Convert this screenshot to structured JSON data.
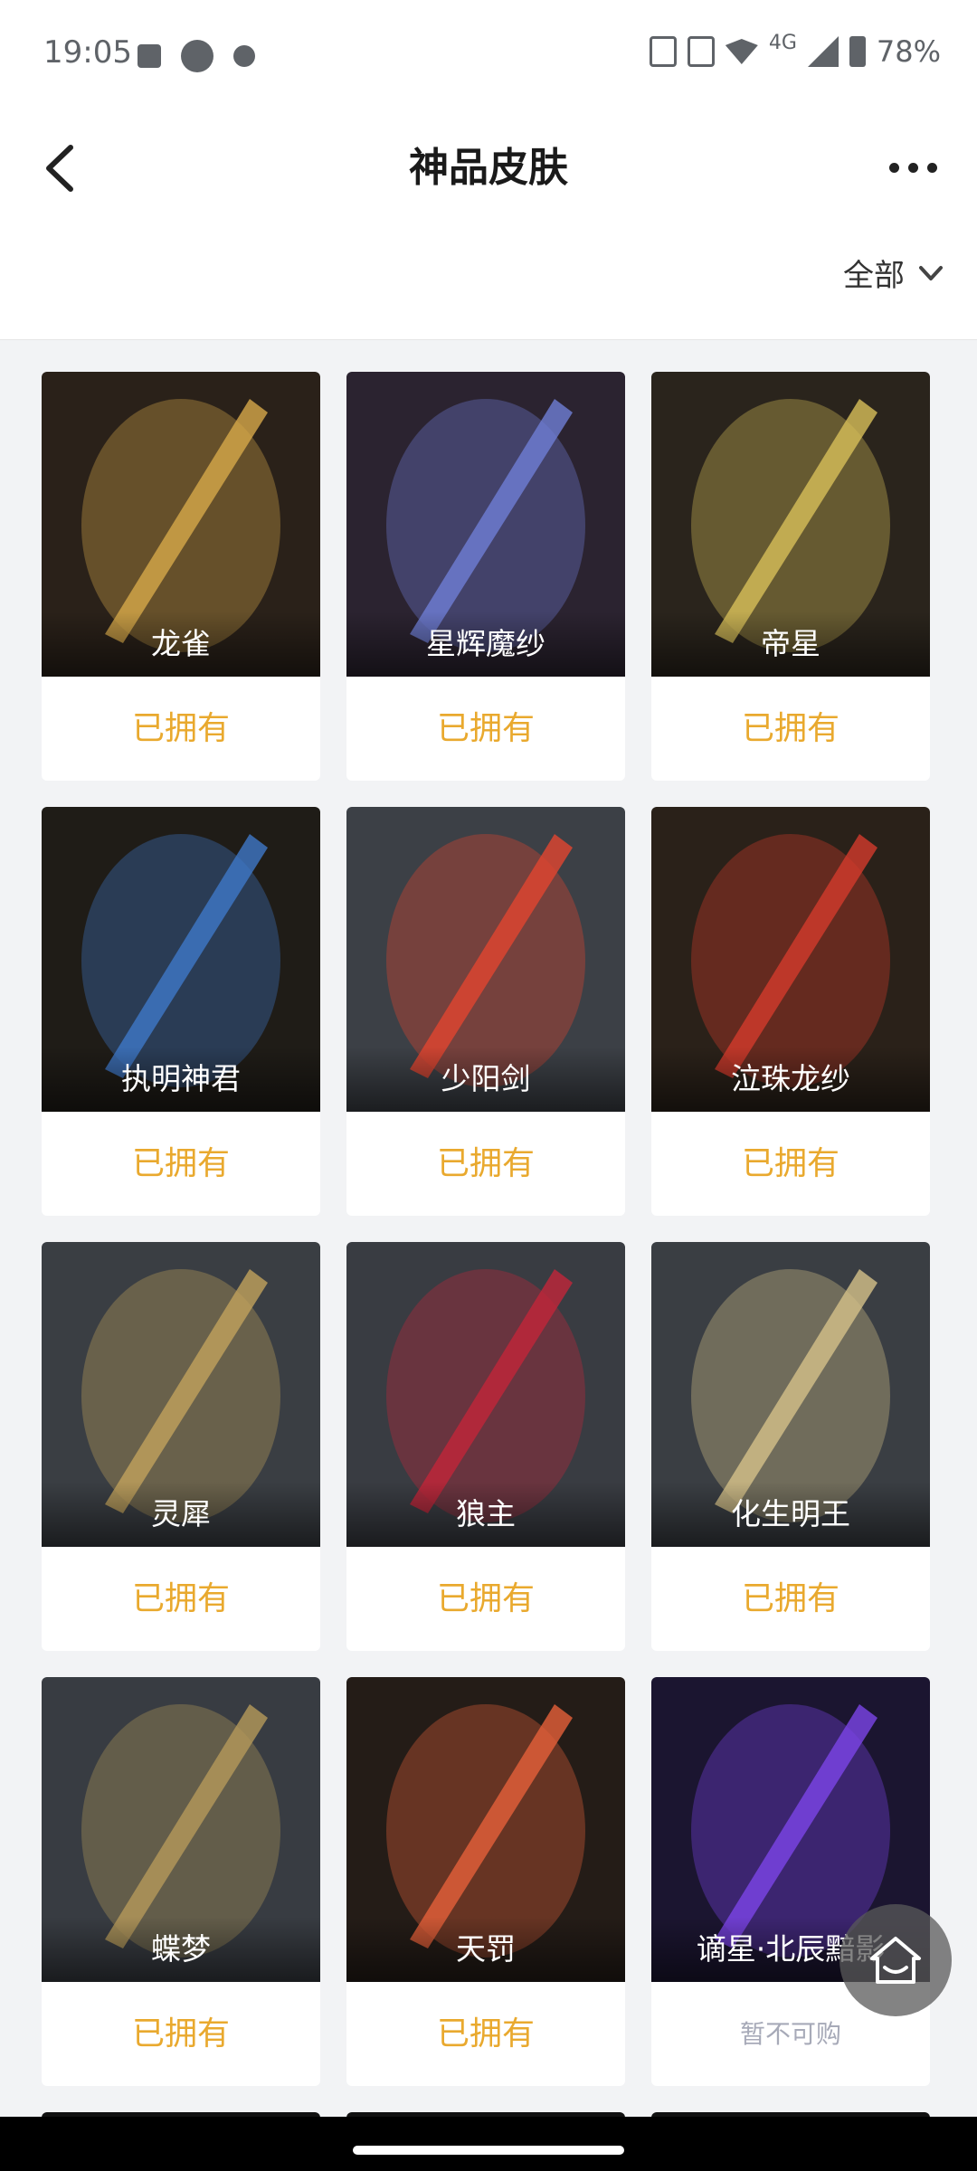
{
  "status_bar": {
    "time": "19:05",
    "network": "4G",
    "battery": "78%"
  },
  "header": {
    "title": "神品皮肤",
    "back_icon": "chevron-left-icon",
    "more_icon": "more-horizontal-icon"
  },
  "filter": {
    "label": "全部",
    "icon": "chevron-down-icon"
  },
  "items": [
    {
      "name": "龙雀",
      "status": "已拥有",
      "bg": "#2a2119",
      "accent": "#d7a94a"
    },
    {
      "name": "星辉魔纱",
      "status": "已拥有",
      "bg": "#2b2330",
      "accent": "#6f7ed6"
    },
    {
      "name": "帝星",
      "status": "已拥有",
      "bg": "#2a241c",
      "accent": "#d8bf5a"
    },
    {
      "name": "执明神君",
      "status": "已拥有",
      "bg": "#1f1c17",
      "accent": "#3f78c8"
    },
    {
      "name": "少阳剑",
      "status": "已拥有",
      "bg": "#3c4046",
      "accent": "#e2452f"
    },
    {
      "name": "泣珠龙纱",
      "status": "已拥有",
      "bg": "#2a2119",
      "accent": "#d33b2c"
    },
    {
      "name": "灵犀",
      "status": "已拥有",
      "bg": "#3a3e43",
      "accent": "#c2a35c"
    },
    {
      "name": "狼主",
      "status": "已拥有",
      "bg": "#393c42",
      "accent": "#c2263a"
    },
    {
      "name": "化生明王",
      "status": "已拥有",
      "bg": "#3a3e43",
      "accent": "#d6c28a"
    },
    {
      "name": "蝶梦",
      "status": "已拥有",
      "bg": "#383c42",
      "accent": "#b59a5a"
    },
    {
      "name": "天罚",
      "status": "已拥有",
      "bg": "#241c17",
      "accent": "#e6603a"
    },
    {
      "name": "谪星·北辰黯影",
      "status": "暂不可购",
      "bg": "#1b1530",
      "accent": "#7c45e8"
    }
  ]
}
